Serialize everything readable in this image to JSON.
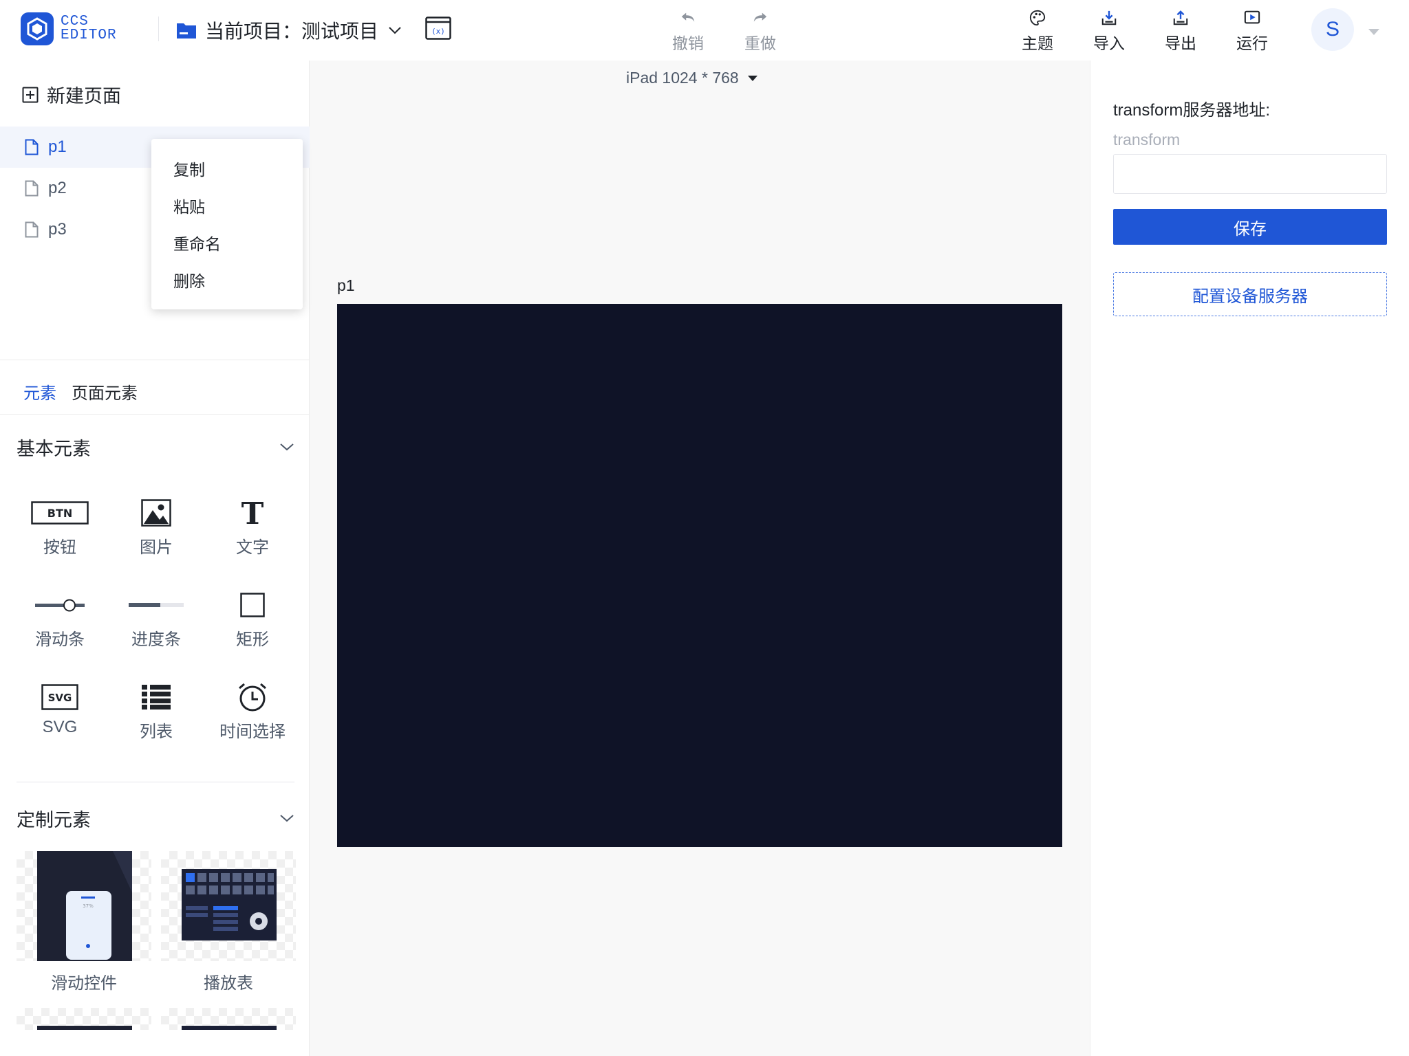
{
  "app": {
    "logo_line1": "CCS",
    "logo_line2": "EDITOR"
  },
  "header": {
    "project_label": "当前项目：测试项目",
    "toolbar": {
      "undo": "撤销",
      "redo": "重做",
      "theme": "主题",
      "import": "导入",
      "export": "导出",
      "run": "运行"
    },
    "user_initial": "S"
  },
  "pages": {
    "new_page_label": "新建页面",
    "items": [
      {
        "label": "p1",
        "active": true
      },
      {
        "label": "p2",
        "active": false
      },
      {
        "label": "p3",
        "active": false
      }
    ]
  },
  "context_menu": {
    "items": [
      {
        "label": "复制"
      },
      {
        "label": "粘贴"
      },
      {
        "label": "重命名"
      },
      {
        "label": "删除"
      }
    ]
  },
  "element_tabs": [
    {
      "label": "元素",
      "active": true
    },
    {
      "label": "页面元素",
      "active": false
    }
  ],
  "basic_elements": {
    "title": "基本元素",
    "items": [
      {
        "label": "按钮",
        "icon": "button-icon",
        "icon_text": "BTN"
      },
      {
        "label": "图片",
        "icon": "image-icon"
      },
      {
        "label": "文字",
        "icon": "text-icon",
        "icon_text": "T"
      },
      {
        "label": "滑动条",
        "icon": "slider-icon"
      },
      {
        "label": "进度条",
        "icon": "progress-icon"
      },
      {
        "label": "矩形",
        "icon": "rectangle-icon"
      },
      {
        "label": "SVG",
        "icon": "svg-icon",
        "icon_text": "SVG"
      },
      {
        "label": "列表",
        "icon": "list-icon"
      },
      {
        "label": "时间选择",
        "icon": "clock-icon"
      }
    ]
  },
  "custom_elements": {
    "title": "定制元素",
    "items": [
      {
        "label": "滑动控件",
        "thumb_text": "37%"
      },
      {
        "label": "播放表"
      }
    ]
  },
  "canvas": {
    "device_label": "iPad 1024 * 768",
    "page_name": "p1",
    "artboard_color": "#0f1327"
  },
  "settings": {
    "transform_title": "transform服务器地址:",
    "transform_hint": "transform",
    "transform_value": "",
    "save_label": "保存",
    "device_server_label": "配置设备服务器"
  },
  "colors": {
    "accent": "#1f56d6",
    "text": "#1f2329",
    "muted": "#4e5969"
  }
}
